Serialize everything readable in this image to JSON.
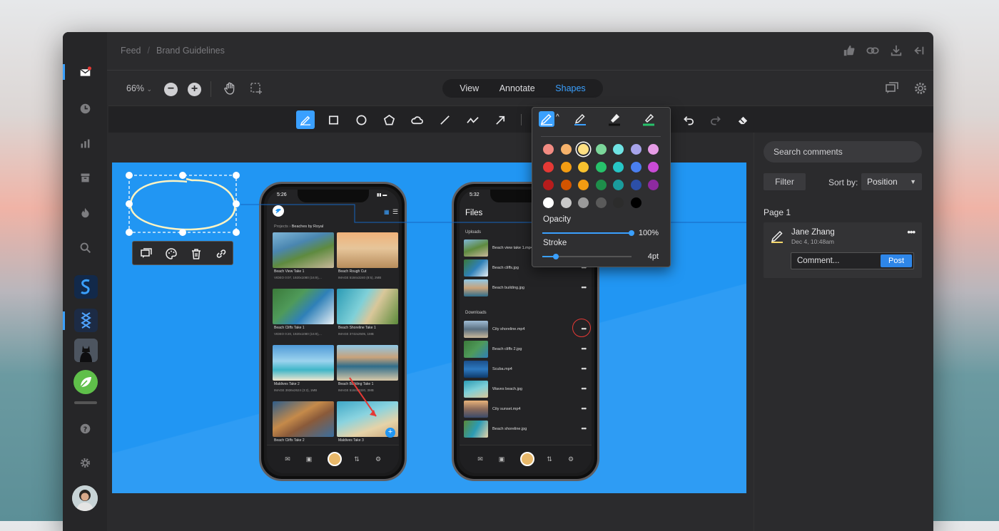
{
  "header": {
    "breadcrumb_root": "Feed",
    "breadcrumb_separator": "/",
    "breadcrumb_current": "Brand Guidelines"
  },
  "toolbar": {
    "zoom_level": "66%",
    "view_tabs": [
      "View",
      "Annotate",
      "Shapes"
    ],
    "active_tab": "Shapes"
  },
  "pen_popup": {
    "opacity_label": "Opacity",
    "opacity_value": "100%",
    "opacity_level": 1.0,
    "stroke_label": "Stroke",
    "stroke_value": "4pt",
    "stroke_level": 0.15,
    "colors": [
      [
        "#f28b82",
        "#f6b26b",
        "#ffe082",
        "#7bd69a",
        "#6fe3e3",
        "#a7a3ea",
        "#e69ce6"
      ],
      [
        "#e53935",
        "#f39c12",
        "#f9c22e",
        "#27c26b",
        "#26c6c6",
        "#4a7ff0",
        "#c94bd6"
      ],
      [
        "#b71c1c",
        "#d35400",
        "#f39c12",
        "#1e8e4a",
        "#1a9c9c",
        "#2c4fa8",
        "#8e2aa0"
      ],
      [
        "#ffffff",
        "#c8c8c8",
        "#9a9a9a",
        "#5a5a5a",
        "#2c2c2c",
        "#000000"
      ]
    ],
    "selected_color": "#ffe082"
  },
  "sidebar": {
    "search_placeholder": "Search comments",
    "filter_label": "Filter",
    "sort_label": "Sort by:",
    "sort_value": "Position",
    "page_label": "Page 1",
    "comment": {
      "author": "Jane Zhang",
      "date": "Dec 4, 10:48am",
      "input_placeholder": "Comment...",
      "post_label": "Post"
    }
  },
  "phone_left": {
    "time": "5:26",
    "crumb": "Projects",
    "crumb_current": "Beaches by Royal",
    "tiles": [
      {
        "title": "Beach View Take 1",
        "tag": "VIDEO",
        "meta": "0:07, 1920x1080 (16:9),..."
      },
      {
        "title": "Beach Rough Cut",
        "tag": "IMAGE",
        "meta": "5184x3240 (8:5), 2MB"
      },
      {
        "title": "Beach Cliffs Take 1",
        "tag": "VIDEO",
        "meta": "0:20, 1920x1080 (16:9),..."
      },
      {
        "title": "Beach Shoreline Take 1",
        "tag": "IMAGE",
        "meta": "3742x2505, 1MB"
      },
      {
        "title": "Maldives Take 2",
        "tag": "IMAGE",
        "meta": "3936x2624 (3:2), 1MB"
      },
      {
        "title": "Beach Building Take 1",
        "tag": "IMAGE",
        "meta": "5184x3320, 3MB"
      },
      {
        "title": "Beach Cliffs Take 2",
        "tag": "",
        "meta": ""
      },
      {
        "title": "Maldives Take 3",
        "tag": "",
        "meta": ""
      }
    ]
  },
  "phone_right": {
    "time": "5:32",
    "title": "Files",
    "uploads_label": "Uploads",
    "downloads_label": "Downloads",
    "uploads": [
      "Beach view take 1.mp4",
      "Beach cliffs.jpg",
      "Beach building.jpg"
    ],
    "downloads": [
      "City shoreline.mp4",
      "Beach cliffs 2.jpg",
      "Scuba.mp4",
      "Waves beach.jpg",
      "City sunset.mp4",
      "Beach shoreline.jpg"
    ]
  },
  "colors": {
    "accent": "#3aa0ff",
    "canvas_blue": "#2196f3"
  }
}
